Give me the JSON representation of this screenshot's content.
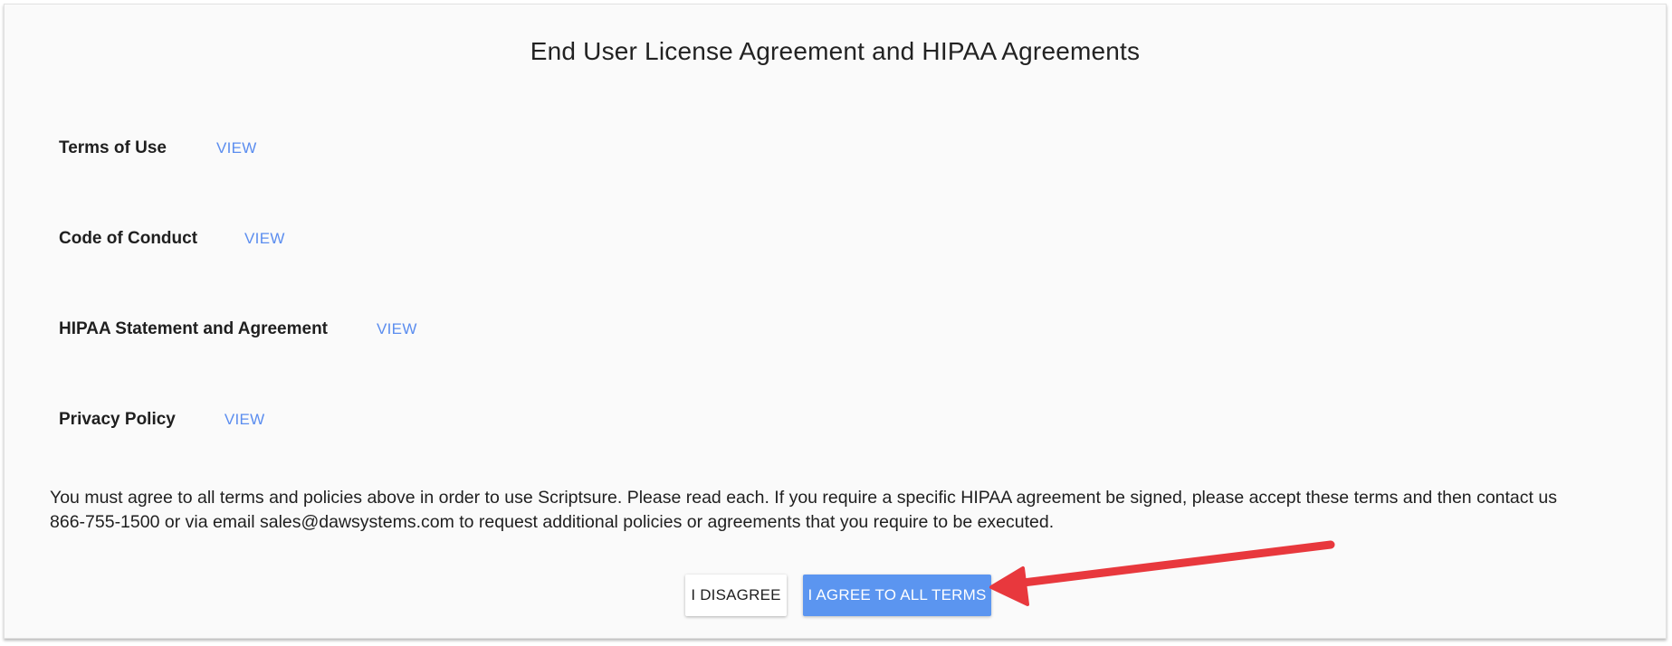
{
  "dialog": {
    "title": "End User License Agreement and HIPAA Agreements"
  },
  "agreements": [
    {
      "label": "Terms of Use",
      "link": "VIEW"
    },
    {
      "label": "Code of Conduct",
      "link": "VIEW"
    },
    {
      "label": "HIPAA Statement and Agreement",
      "link": "VIEW"
    },
    {
      "label": "Privacy Policy",
      "link": "VIEW"
    }
  ],
  "notice": {
    "line1": "You must agree to all terms and policies above in order to use Scriptsure. Please read each. If you require a specific HIPAA agreement be signed, please accept these terms and then contact us",
    "line2": "866-755-1500 or via email sales@dawsystems.com to request additional policies or agreements that you require to be executed."
  },
  "buttons": {
    "disagree": "I DISAGREE",
    "agree": "I AGREE TO ALL TERMS"
  },
  "colors": {
    "link": "#5b8def",
    "primary_button": "#5b95f0",
    "annotation_arrow": "#e8383d"
  },
  "annotation": {
    "icon": "red-arrow-icon"
  }
}
